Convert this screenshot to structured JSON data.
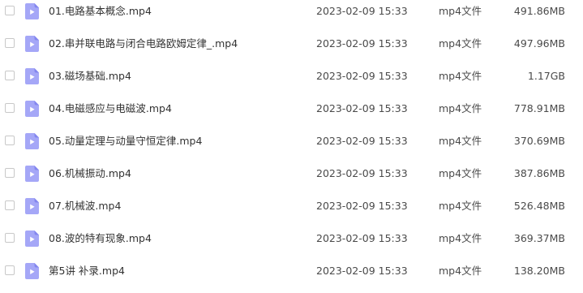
{
  "colors": {
    "icon_fill": "#a5a7f7",
    "icon_fold": "#8487ee",
    "checkbox_border": "#c8c8c8",
    "text": "#333333"
  },
  "files": [
    {
      "name": "01.电路基本概念.mp4",
      "date": "2023-02-09 15:33",
      "type": "mp4文件",
      "size": "491.86MB",
      "icon": "video-file-icon"
    },
    {
      "name": "02.串并联电路与闭合电路欧姆定律_.mp4",
      "date": "2023-02-09 15:33",
      "type": "mp4文件",
      "size": "497.96MB",
      "icon": "video-file-icon"
    },
    {
      "name": "03.磁场基础.mp4",
      "date": "2023-02-09 15:33",
      "type": "mp4文件",
      "size": "1.17GB",
      "icon": "video-file-icon"
    },
    {
      "name": "04.电磁感应与电磁波.mp4",
      "date": "2023-02-09 15:33",
      "type": "mp4文件",
      "size": "778.91MB",
      "icon": "video-file-icon"
    },
    {
      "name": "05.动量定理与动量守恒定律.mp4",
      "date": "2023-02-09 15:33",
      "type": "mp4文件",
      "size": "370.69MB",
      "icon": "video-file-icon"
    },
    {
      "name": "06.机械振动.mp4",
      "date": "2023-02-09 15:33",
      "type": "mp4文件",
      "size": "387.86MB",
      "icon": "video-file-icon"
    },
    {
      "name": "07.机械波.mp4",
      "date": "2023-02-09 15:33",
      "type": "mp4文件",
      "size": "526.48MB",
      "icon": "video-file-icon"
    },
    {
      "name": "08.波的特有现象.mp4",
      "date": "2023-02-09 15:33",
      "type": "mp4文件",
      "size": "369.37MB",
      "icon": "video-file-icon"
    },
    {
      "name": "第5讲 补录.mp4",
      "date": "2023-02-09 15:33",
      "type": "mp4文件",
      "size": "138.20MB",
      "icon": "video-file-icon"
    }
  ]
}
